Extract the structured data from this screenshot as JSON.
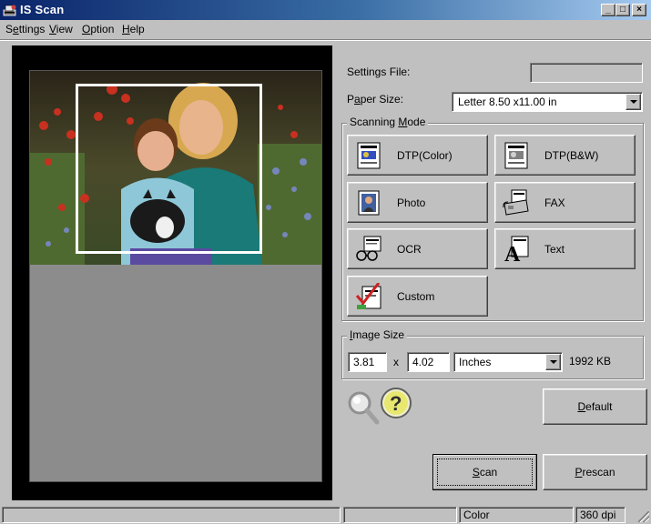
{
  "window": {
    "title": "IS Scan",
    "icon": "scanner-app-icon",
    "min_glyph": "_",
    "max_glyph": "□",
    "close_glyph": "×"
  },
  "menu": [
    {
      "label": "Settings",
      "accel": "e"
    },
    {
      "label": "View",
      "accel": "V"
    },
    {
      "label": "Option",
      "accel": "O"
    },
    {
      "label": "Help",
      "accel": "H"
    }
  ],
  "settings_file": {
    "label": "Settings File:",
    "value": ""
  },
  "paper_size": {
    "label": "Paper Size:",
    "value": "Letter 8.50 x11.00 in"
  },
  "scanning_mode": {
    "title": "Scanning Mode",
    "buttons": [
      {
        "label": "DTP(Color)",
        "icon": "dtp-color-icon"
      },
      {
        "label": "DTP(B&W)",
        "icon": "dtp-bw-icon"
      },
      {
        "label": "Photo",
        "icon": "photo-icon"
      },
      {
        "label": "FAX",
        "icon": "fax-icon"
      },
      {
        "label": "OCR",
        "icon": "ocr-glasses-icon"
      },
      {
        "label": "Text",
        "icon": "text-icon"
      },
      {
        "label": "Custom",
        "icon": "custom-checkmark-icon"
      }
    ]
  },
  "image_size": {
    "title": "Image Size",
    "width": "3.81",
    "separator": "x",
    "height": "4.02",
    "unit": "Inches",
    "file_size": "1992 KB"
  },
  "buttons": {
    "default": "Default",
    "scan": "Scan",
    "prescan": "Prescan"
  },
  "status": {
    "cell1": "",
    "mode": "Color",
    "dpi": "360 dpi"
  },
  "colors": {
    "titlebar_start": "#0a246a",
    "titlebar_end": "#a6caf0",
    "face": "#c0c0c0",
    "preview_bg": "#8c8c8c"
  }
}
